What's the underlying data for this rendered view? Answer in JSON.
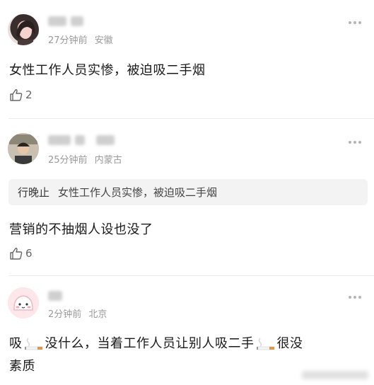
{
  "comments": [
    {
      "time": "27分钟前",
      "location": "安徽",
      "text": "女性工作人员实惨，被迫吸二手烟",
      "likes": "2",
      "name_blurred": true
    },
    {
      "time": "25分钟前",
      "location": "内蒙古",
      "quote_user": "行晚止",
      "quote_text": "女性工作人员实惨，被迫吸二手烟",
      "text": "营销的不抽烟人设也没了",
      "likes": "6",
      "name_blurred": true
    },
    {
      "time": "2分钟前",
      "location": "北京",
      "text_part1": "吸",
      "text_part2": "没什么，当着工作人员让别人吸二手",
      "text_part3": "很没",
      "text_line2": "素质",
      "name_blurred": true
    }
  ],
  "icons": {
    "like": "thumbs-up-icon",
    "more": "more-dots-icon",
    "cigarette": "cigarette-emoji-icon"
  },
  "colors": {
    "meta": "#9a9a9a",
    "quote_bg": "#f3f3f3",
    "divider": "#ececec"
  }
}
